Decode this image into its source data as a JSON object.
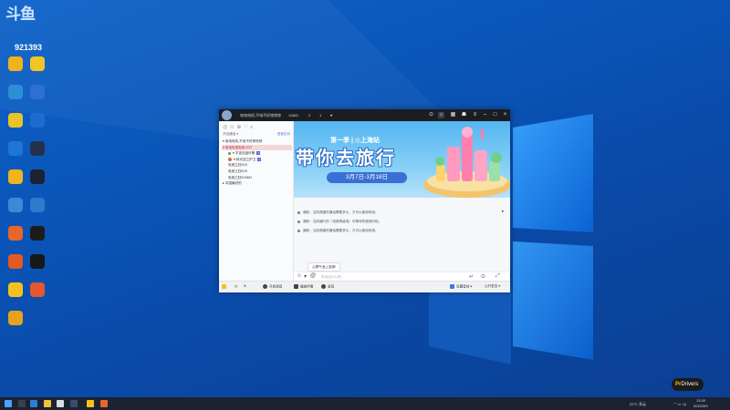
{
  "stream_overlay": {
    "logo_text": "斗鱼",
    "room_number": "921393"
  },
  "desktop_icons": [
    {
      "icon": "browser-icon",
      "color": "#f2b21b"
    },
    {
      "icon": "media-icon",
      "color": "#f2c526"
    },
    {
      "icon": "edge-icon",
      "color": "#2c8fd6"
    },
    {
      "icon": "app-icon",
      "color": "#2e6fd1"
    },
    {
      "icon": "chrome-icon",
      "color": "#e8c42a"
    },
    {
      "icon": "app-icon",
      "color": "#1d6ad0"
    },
    {
      "icon": "store-icon",
      "color": "#1f76d4"
    },
    {
      "icon": "steam-icon",
      "color": "#23324a"
    },
    {
      "icon": "game-icon",
      "color": "#f0b51c"
    },
    {
      "icon": "app-icon",
      "color": "#1b2230"
    },
    {
      "icon": "gear-icon",
      "color": "#3c8ad6"
    },
    {
      "icon": "settings-icon",
      "color": "#2d7bcc"
    },
    {
      "icon": "launcher-icon",
      "color": "#e8662c"
    },
    {
      "icon": "nvidia-icon",
      "color": "#1c1c1c"
    },
    {
      "icon": "recorder-icon",
      "color": "#e25a22"
    },
    {
      "icon": "qq-icon",
      "color": "#181818"
    },
    {
      "icon": "cloud-icon",
      "color": "#f3c020"
    },
    {
      "icon": "box-icon",
      "color": "#e5572d"
    },
    {
      "icon": "pdf-icon",
      "color": "#e7a21c"
    }
  ],
  "window": {
    "title": "电电电机,不电不好惊惊惊",
    "toolbar_items": [
      "10801",
      "2",
      "1",
      "♥"
    ],
    "left_panel": {
      "tools": [
        "◎",
        "☺",
        "⊕",
        "♡",
        "⌕"
      ],
      "header_left": "开启通话 ▾",
      "header_right": "语音队列",
      "tree": [
        {
          "text": "▾ 电电电机,不电不好惊惊惊",
          "selected": false,
          "indent": 0
        },
        {
          "text": "▾ 电电电电电电 0/37",
          "selected": true,
          "indent": 0
        },
        {
          "text": "▾ 宇宙无敌坏蛋",
          "selected": false,
          "indent": 1,
          "dot": true,
          "badge": "V"
        },
        {
          "text": "▾ 斜光逆之护卫",
          "selected": false,
          "indent": 1,
          "avatar": true,
          "badge": "V"
        },
        {
          "text": "电竞之狂5V5",
          "selected": false,
          "indent": 1
        },
        {
          "text": "电竞之狂5V5",
          "selected": false,
          "indent": 1
        },
        {
          "text": "电竞之狂5V5DN",
          "selected": false,
          "indent": 1
        },
        {
          "text": "▸ 中国最好的",
          "selected": false,
          "indent": 0
        }
      ]
    },
    "banner": {
      "subtitle": "第一季 | ◎上海站",
      "headline": "带你去旅行",
      "dates": "3月7日-3月18日"
    },
    "messages": [
      "通知：当前频道的通话需要多久，方可以使用电竞。",
      "通知：当前通行的（电竞等级电）可等待的使用时段。",
      "通知：当前频道的通话需要多久，方可以使用电竞。"
    ],
    "chip": "公屏气泡上选择!",
    "input_placeholder": "来说点什么吧...",
    "bottom_bar": [
      "开启语音",
      "播放伴奏",
      "录音"
    ],
    "bottom_right": [
      "设置音效 ▾",
      "公开发言 ▾"
    ]
  },
  "taskbar": {
    "weather": "22°C 多云",
    "time": "13:30",
    "date": "2022/3/9"
  },
  "watermark": {
    "text_a": "Pr",
    "text_b": "Drivers"
  }
}
